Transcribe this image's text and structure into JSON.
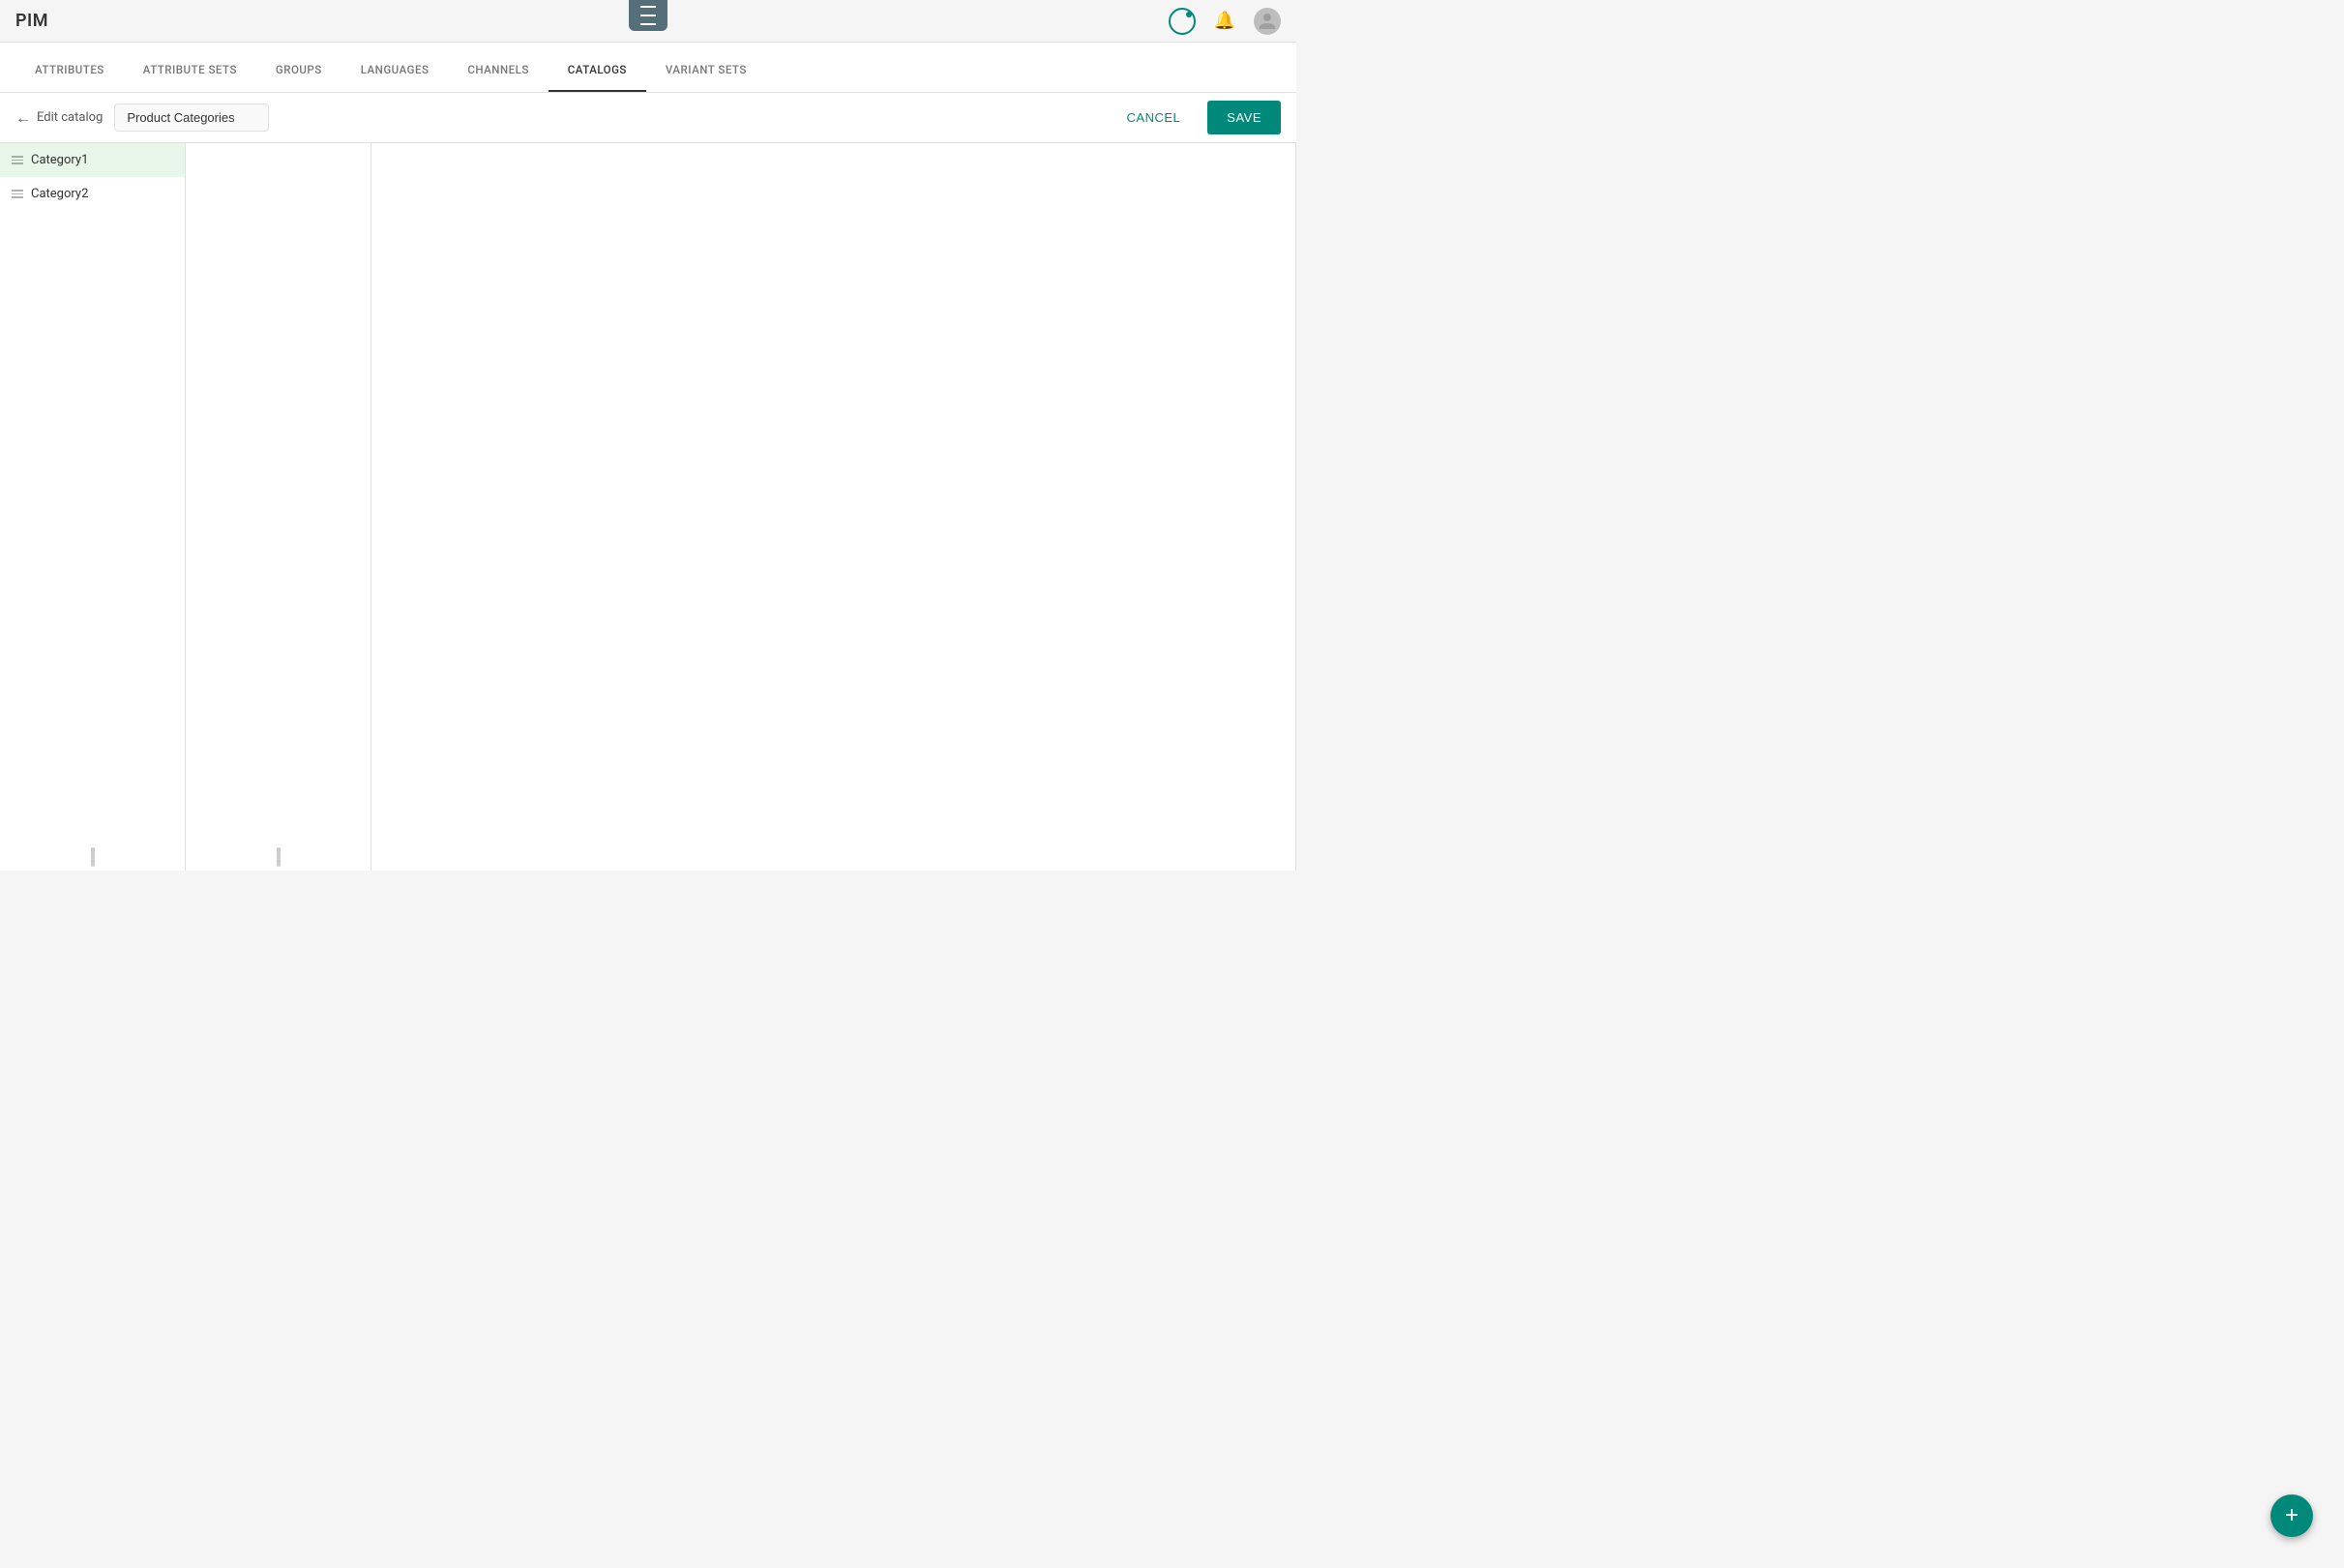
{
  "app": {
    "logo": "PIM"
  },
  "header": {
    "toolbar_icon": "menu-icon"
  },
  "nav": {
    "tabs": [
      {
        "id": "attributes",
        "label": "ATTRIBUTES",
        "active": false
      },
      {
        "id": "attribute-sets",
        "label": "ATTRIBUTE SETS",
        "active": false
      },
      {
        "id": "groups",
        "label": "GROUPS",
        "active": false
      },
      {
        "id": "languages",
        "label": "LANGUAGES",
        "active": false
      },
      {
        "id": "channels",
        "label": "CHANNELS",
        "active": false
      },
      {
        "id": "catalogs",
        "label": "CATALOGS",
        "active": true
      },
      {
        "id": "variant-sets",
        "label": "VARIANT SETS",
        "active": false
      }
    ]
  },
  "edit_bar": {
    "back_label": "Edit catalog",
    "catalog_name": "Product Categories",
    "cancel_label": "CANCEL",
    "save_label": "SAVE"
  },
  "categories": {
    "col1": [
      {
        "id": "cat1",
        "label": "Category1",
        "selected": true
      },
      {
        "id": "cat2",
        "label": "Category2",
        "selected": false
      }
    ],
    "col2": [],
    "col3": []
  },
  "fab": {
    "label": "+"
  }
}
